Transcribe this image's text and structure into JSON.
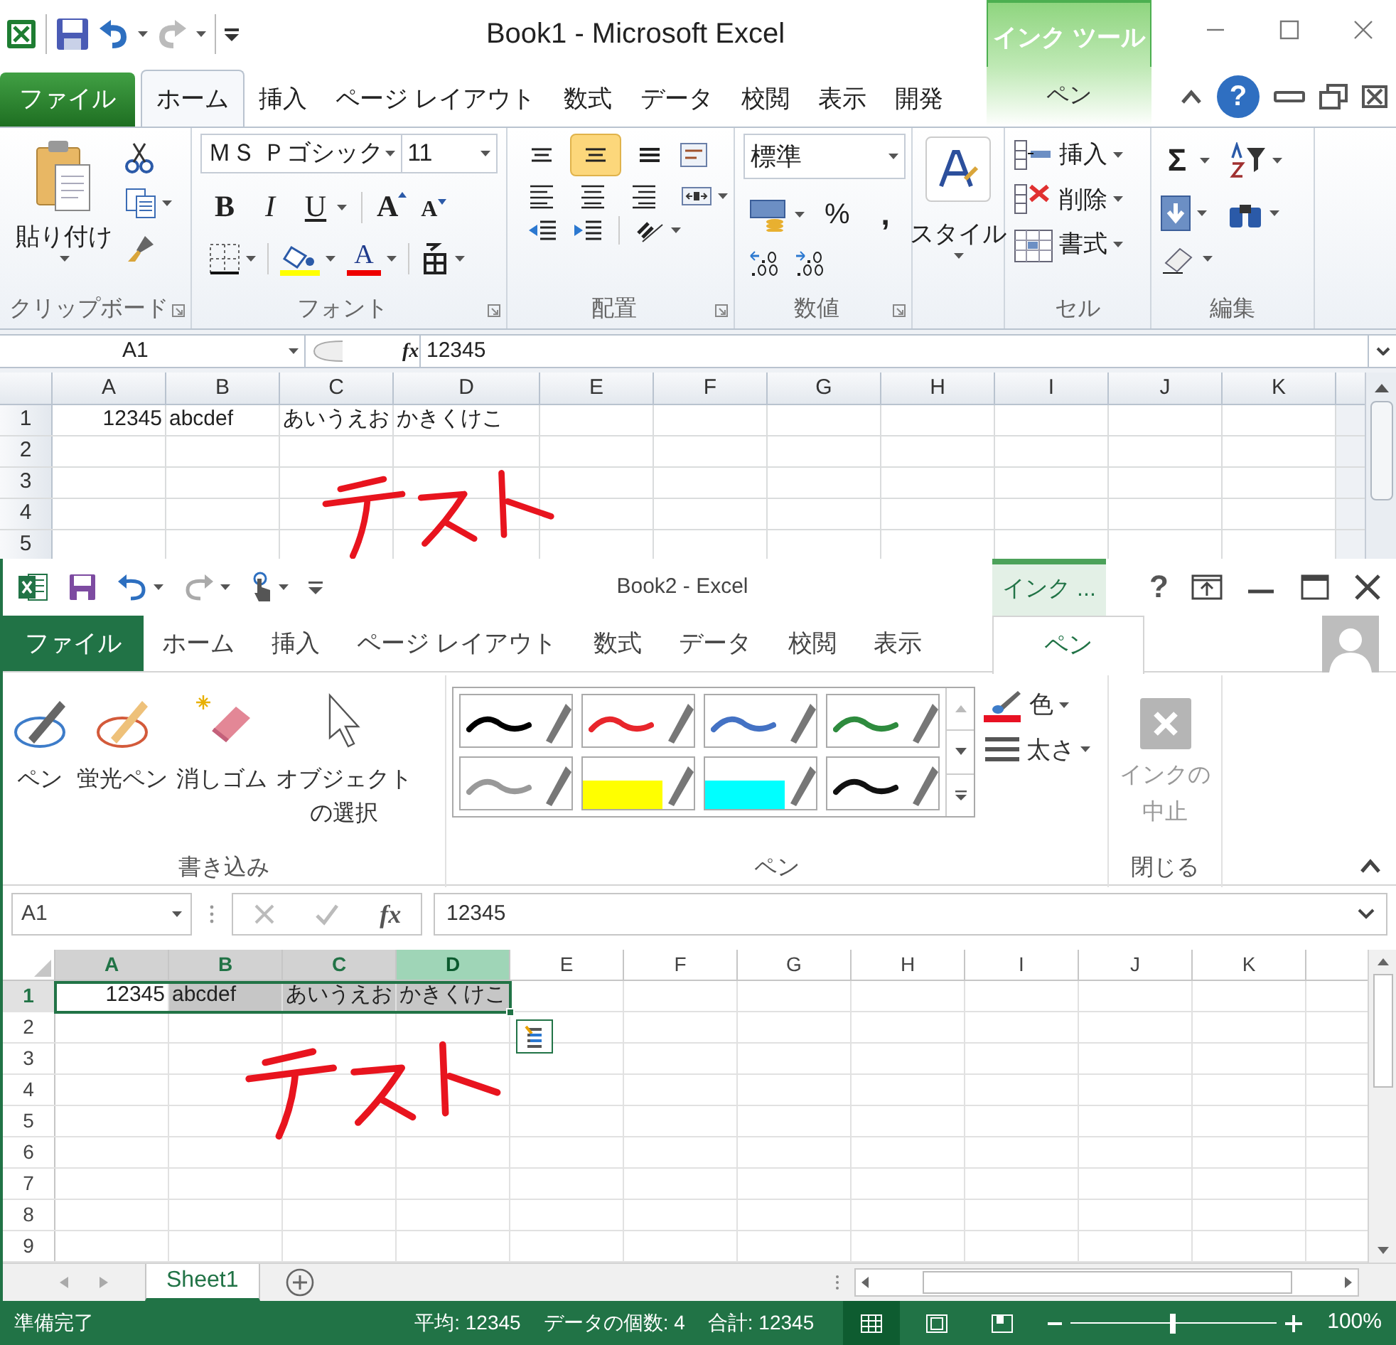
{
  "window_1": {
    "title": "Book1 - Microsoft Excel",
    "contextual_group": "インク ツール",
    "help": "?",
    "tabs": [
      {
        "label": "ファイル",
        "kind": "file",
        "selected": false
      },
      {
        "label": "ホーム",
        "kind": "tab",
        "selected": true
      },
      {
        "label": "挿入",
        "kind": "tab",
        "selected": false
      },
      {
        "label": "ページ レイアウト",
        "kind": "tab",
        "selected": false
      },
      {
        "label": "数式",
        "kind": "tab",
        "selected": false
      },
      {
        "label": "データ",
        "kind": "tab",
        "selected": false
      },
      {
        "label": "校閲",
        "kind": "tab",
        "selected": false
      },
      {
        "label": "表示",
        "kind": "tab",
        "selected": false
      },
      {
        "label": "開発",
        "kind": "tab",
        "selected": false
      },
      {
        "label": "ペン",
        "kind": "contextual",
        "selected": false
      }
    ],
    "clipboard_group": {
      "paste": "貼り付け",
      "label": "クリップボード"
    },
    "font_group": {
      "font_name": "ＭＳ Ｐゴシック",
      "font_size": "11",
      "bold": "B",
      "italic": "I",
      "underline": "U",
      "grow_font": "A",
      "shrink_font": "A",
      "font_color": "A",
      "label": "フォント"
    },
    "alignment_group": {
      "label": "配置",
      "vertical_align": [
        {
          "kind": "top",
          "selected": false
        },
        {
          "kind": "middle",
          "selected": true
        },
        {
          "kind": "bottom",
          "selected": false
        }
      ]
    },
    "number_group": {
      "format": "標準",
      "percent": "%",
      "comma": ",",
      "label": "数値"
    },
    "styles_button": "スタイル",
    "cells_group": {
      "insert": "挿入",
      "delete": "削除",
      "format": "書式",
      "label": "セル"
    },
    "editing_group": {
      "sum": "Σ",
      "label": "編集"
    },
    "formula_bar": {
      "name_box": "A1",
      "fx": "fx",
      "value": "12345"
    },
    "grid": {
      "columns": [
        "A",
        "B",
        "C",
        "D",
        "E",
        "F",
        "G",
        "H",
        "I",
        "J",
        "K"
      ],
      "rows": [
        "1",
        "2",
        "3",
        "4",
        "5"
      ],
      "cells": [
        [
          "12345",
          "abcdef",
          "あいうえお",
          "かきくけこ"
        ]
      ]
    }
  },
  "window_2": {
    "title": "Book2 - Excel",
    "contextual_group": "インク ...",
    "help": "?",
    "tabs": [
      {
        "label": "ファイル",
        "kind": "file",
        "selected": false
      },
      {
        "label": "ホーム",
        "kind": "tab",
        "selected": false
      },
      {
        "label": "挿入",
        "kind": "tab",
        "selected": false
      },
      {
        "label": "ページ レイアウト",
        "kind": "tab",
        "selected": false
      },
      {
        "label": "数式",
        "kind": "tab",
        "selected": false
      },
      {
        "label": "データ",
        "kind": "tab",
        "selected": false
      },
      {
        "label": "校閲",
        "kind": "tab",
        "selected": false
      },
      {
        "label": "表示",
        "kind": "tab",
        "selected": false
      },
      {
        "label": "ペン",
        "kind": "contextual",
        "selected": true
      }
    ],
    "writing_group": {
      "label": "書き込み",
      "tools": [
        {
          "kind": "pen",
          "label": "ペン"
        },
        {
          "kind": "highlighter",
          "label": "蛍光ペン"
        },
        {
          "kind": "eraser",
          "label": "消しゴム"
        },
        {
          "kind": "select",
          "label": "オブジェクトの選択"
        }
      ]
    },
    "pens_group": {
      "label": "ペン",
      "styles": [
        {
          "kind": "pen",
          "color": "#000000"
        },
        {
          "kind": "pen",
          "color": "#e8262c"
        },
        {
          "kind": "pen",
          "color": "#4472c4"
        },
        {
          "kind": "pen",
          "color": "#2e8b3e"
        },
        {
          "kind": "pen",
          "color": "#999999"
        },
        {
          "kind": "highlighter",
          "color": "#ffff00"
        },
        {
          "kind": "highlighter",
          "color": "#00ffff"
        },
        {
          "kind": "pen",
          "color": "#111111"
        }
      ],
      "color_button": {
        "label": "色",
        "color": "#e81123"
      },
      "thickness_button": "太さ"
    },
    "close_group": {
      "label": "閉じる",
      "stop_inking": {
        "label": "インクの中止",
        "disabled": true
      }
    },
    "formula_bar": {
      "name_box": "A1",
      "fx": "fx",
      "value": "12345"
    },
    "grid": {
      "columns": [
        {
          "label": "A",
          "selected": true,
          "hovered": false
        },
        {
          "label": "B",
          "selected": true,
          "hovered": false
        },
        {
          "label": "C",
          "selected": true,
          "hovered": false
        },
        {
          "label": "D",
          "selected": true,
          "hovered": true
        },
        {
          "label": "E",
          "selected": false,
          "hovered": false
        },
        {
          "label": "F",
          "selected": false,
          "hovered": false
        },
        {
          "label": "G",
          "selected": false,
          "hovered": false
        },
        {
          "label": "H",
          "selected": false,
          "hovered": false
        },
        {
          "label": "I",
          "selected": false,
          "hovered": false
        },
        {
          "label": "J",
          "selected": false,
          "hovered": false
        },
        {
          "label": "K",
          "selected": false,
          "hovered": false
        }
      ],
      "rows": [
        {
          "label": "1",
          "selected": true
        },
        {
          "label": "2",
          "selected": false
        },
        {
          "label": "3",
          "selected": false
        },
        {
          "label": "4",
          "selected": false
        },
        {
          "label": "5",
          "selected": false
        },
        {
          "label": "6",
          "selected": false
        },
        {
          "label": "7",
          "selected": false
        },
        {
          "label": "8",
          "selected": false
        },
        {
          "label": "9",
          "selected": false
        }
      ],
      "cells": [
        [
          {
            "value": "12345",
            "active": true
          },
          {
            "value": "abcdef",
            "active": false
          },
          {
            "value": "あいうえお",
            "active": false
          },
          {
            "value": "かきくけこ",
            "active": false
          }
        ]
      ]
    },
    "sheet_tabs": [
      {
        "label": "Sheet1",
        "selected": true
      }
    ],
    "status_bar": {
      "mode": "準備完了",
      "average": "平均: 12345",
      "count": "データの個数: 4",
      "sum": "合計: 12345",
      "views": [
        {
          "kind": "normal",
          "selected": true
        },
        {
          "kind": "page_layout",
          "selected": false
        },
        {
          "kind": "page_break",
          "selected": false
        }
      ],
      "zoom": {
        "level": 0.5,
        "reading": "100%"
      }
    }
  }
}
